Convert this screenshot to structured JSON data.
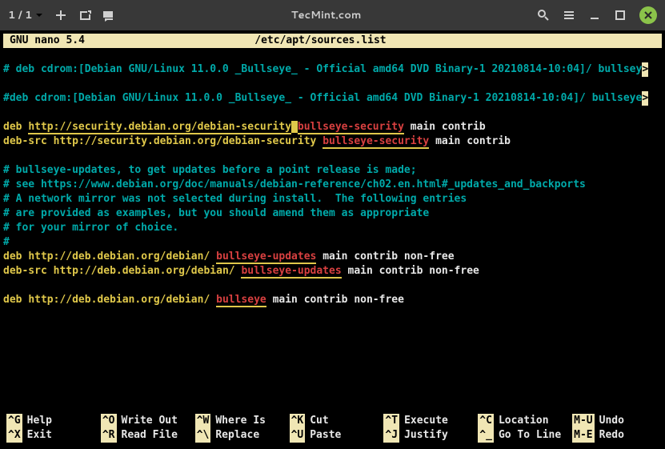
{
  "titlebar": {
    "page_counter": "1 / 1",
    "title": "TecMint.com"
  },
  "nano": {
    "version_label": "GNU nano 5.4",
    "filename": "/etc/apt/sources.list"
  },
  "lines": {
    "l1_prefix": "# deb cdrom:[Debian GNU/Linux 11.0.0 _Bullseye_ - Official amd64 DVD Binary-1 20210814-10:04]/ bullsey",
    "l1_arrow": ">",
    "l2_blank": "",
    "l3_prefix": "#deb cdrom:[Debian GNU/Linux 11.0.0 _Bullseye_ - Official amd64 DVD Binary-1 20210814-10:04]/ bullseye",
    "l3_arrow": ">",
    "l4_blank": "",
    "l5_a": "deb",
    "l5_b": "http://security.debian.org/debian-security",
    "l5_sp": " ",
    "l5_c": "bullseye-security",
    "l5_d": "main contrib",
    "l6_a": "deb-src",
    "l6_b": "http://security.debian.org/debian-security",
    "l6_c": "bullseye-security",
    "l6_d": "main contrib",
    "l7_blank": "",
    "l8": "# bullseye-updates, to get updates before a point release is made;",
    "l9": "# see https://www.debian.org/doc/manuals/debian-reference/ch02.en.html#_updates_and_backports",
    "l10": "# A network mirror was not selected during install.  The following entries",
    "l11": "# are provided as examples, but you should amend them as appropriate",
    "l12": "# for your mirror of choice.",
    "l13": "#",
    "l14_a": "deb",
    "l14_b": "http://deb.debian.org/debian/",
    "l14_c": "bullseye-updates",
    "l14_d": "main contrib non-free",
    "l15_a": "deb-src",
    "l15_b": "http://deb.debian.org/debian/",
    "l15_c": "bullseye-updates",
    "l15_d": "main contrib non-free",
    "l16_blank": "",
    "l17_a": "deb",
    "l17_b": "http://deb.debian.org/debian/",
    "l17_c": "bullseye",
    "l17_d": "main contrib non-free"
  },
  "footer": [
    {
      "key": "^G",
      "label": "Help"
    },
    {
      "key": "^O",
      "label": "Write Out"
    },
    {
      "key": "^W",
      "label": "Where Is"
    },
    {
      "key": "^K",
      "label": "Cut"
    },
    {
      "key": "^T",
      "label": "Execute"
    },
    {
      "key": "^C",
      "label": "Location"
    },
    {
      "key": "M-U",
      "label": "Undo"
    },
    {
      "key": "^X",
      "label": "Exit"
    },
    {
      "key": "^R",
      "label": "Read File"
    },
    {
      "key": "^\\",
      "label": "Replace"
    },
    {
      "key": "^U",
      "label": "Paste"
    },
    {
      "key": "^J",
      "label": "Justify"
    },
    {
      "key": "^_",
      "label": "Go To Line"
    },
    {
      "key": "M-E",
      "label": "Redo"
    }
  ]
}
